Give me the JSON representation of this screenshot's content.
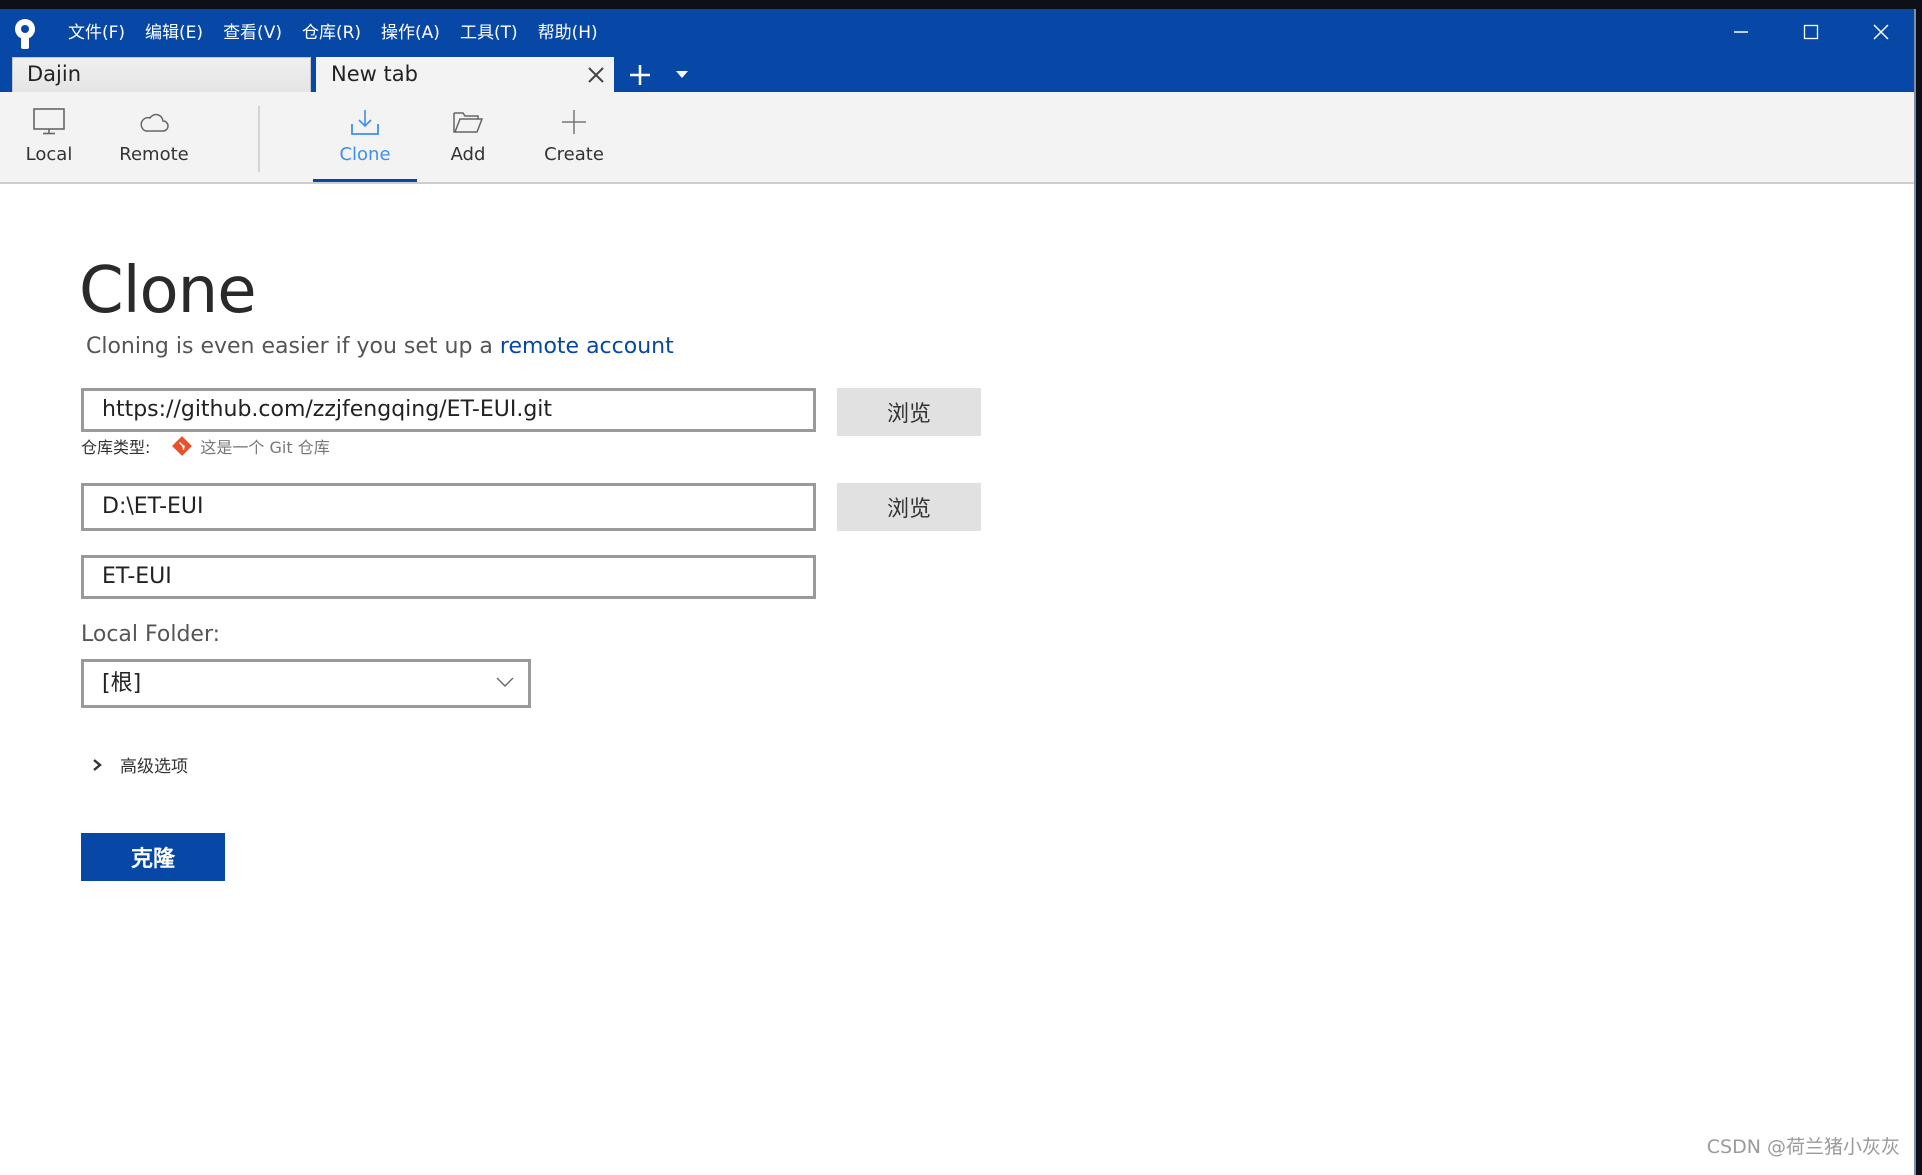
{
  "window": {
    "app_logo": "sourcetree-logo",
    "menu": [
      "文件(F)",
      "编辑(E)",
      "查看(V)",
      "仓库(R)",
      "操作(A)",
      "工具(T)",
      "帮助(H)"
    ],
    "controls": {
      "minimize": "minimize-icon",
      "maximize": "maximize-icon",
      "close": "close-icon"
    }
  },
  "tabs": [
    {
      "label": "Dajin",
      "active": false
    },
    {
      "label": "New tab",
      "active": true,
      "closable": true
    }
  ],
  "tab_actions": {
    "add": "plus-icon",
    "menu": "caret-down-icon"
  },
  "toolbar": {
    "items": [
      {
        "label": "Local",
        "icon": "monitor-icon",
        "active": false
      },
      {
        "label": "Remote",
        "icon": "cloud-icon",
        "active": false
      },
      {
        "label": "Clone",
        "icon": "download-icon",
        "active": true
      },
      {
        "label": "Add",
        "icon": "folder-open-icon",
        "active": false
      },
      {
        "label": "Create",
        "icon": "plus-icon",
        "active": false
      }
    ]
  },
  "clone": {
    "title": "Clone",
    "subtitle_prefix": "Cloning is even easier if you set up a ",
    "subtitle_link": "remote account",
    "source_url": "https://github.com/zzjfengqing/ET-EUI.git",
    "browse_label": "浏览",
    "repo_type_label": "仓库类型:",
    "repo_type_value": "这是一个 Git 仓库",
    "destination_path": "D:\\ET-EUI",
    "name": "ET-EUI",
    "local_folder_label": "Local Folder:",
    "local_folder_value": "[根]",
    "advanced_label": "高级选项",
    "submit_label": "克隆"
  },
  "colors": {
    "brand": "#0748a7",
    "active_tab_text": "#3e8ff0",
    "git_icon": "#e8512a"
  },
  "watermark": "CSDN @荷兰猪小灰灰"
}
